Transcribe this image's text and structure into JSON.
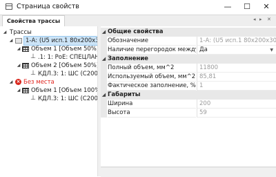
{
  "window": {
    "title": "Страница свойств",
    "minimize": "—",
    "maximize": "☐",
    "close": "✕"
  },
  "tabs": {
    "active": "Свойства трассы",
    "controls": {
      "left": "◂",
      "right": "▸",
      "close": "✕"
    }
  },
  "tree": {
    "root": "Трассы",
    "selected": "1-А: (U5 исп.1 80х200х3000)",
    "vol1": "Объем 1 [Объем 50%] [3...",
    "cable1": ".1: 1: РоЕ: СПЕЦЛАН  U...",
    "vol2": "Объем 2 [Объем 50%] [3...",
    "cable2": "КДЛ.3: 1: ШС  (С2000-...",
    "no_place": "Без места",
    "vol3": "Объем 1 [Объем 100%] [...",
    "cable3": "КДЛ.3: 1: ШС  (С2000-...",
    "icons": {
      "trasse": "trasse-icon",
      "volume": "volume-grid-icon",
      "cable": "cable-icon",
      "error": "error-icon"
    }
  },
  "properties": {
    "general": {
      "title": "Общие свойства",
      "designation_label": "Обозначение",
      "designation_value": "1-А: (U5 исп.1 80х200х3000)",
      "partitions_label": "Наличие перегородок между объем...",
      "partitions_value": "Да"
    },
    "filling": {
      "title": "Заполнение",
      "full_label": "Полный объем, мм^2",
      "full_value": "11800",
      "used_label": "Используемый объем, мм^2",
      "used_value": "85,81",
      "actual_label": "Фактическое заполнение, %",
      "actual_value": "1"
    },
    "dimensions": {
      "title": "Габариты",
      "width_label": "Ширина",
      "width_value": "200",
      "height_label": "Высота",
      "height_value": "59"
    }
  },
  "colors": {
    "selection": "#cce4f7",
    "error": "#d9261c",
    "category_bg": "#e8e8e8"
  }
}
